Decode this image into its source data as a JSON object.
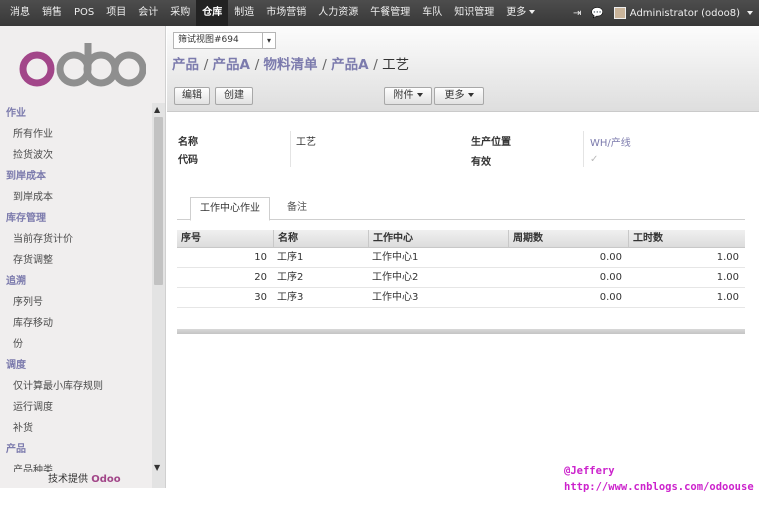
{
  "topbar": {
    "menu": [
      "消息",
      "销售",
      "POS",
      "项目",
      "会计",
      "采购",
      "仓库",
      "制造",
      "市场营销",
      "人力资源",
      "午餐管理",
      "车队",
      "知识管理",
      "更多"
    ],
    "active": "仓库",
    "user": "Administrator (odoo8)"
  },
  "sidebar": {
    "logo": "odoo",
    "sections": [
      {
        "title": "作业",
        "items": [
          "所有作业",
          "捡货波次"
        ]
      },
      {
        "title": "到岸成本",
        "items": [
          "到岸成本"
        ]
      },
      {
        "title": "库存管理",
        "items": [
          "当前存货计价",
          "存货调整"
        ]
      },
      {
        "title": "追溯",
        "items": [
          "序列号",
          "库存移动",
          "份"
        ]
      },
      {
        "title": "调度",
        "items": [
          "仅计算最小库存规则",
          "运行调度",
          "补货"
        ]
      },
      {
        "title": "产品",
        "items": [
          "产品种类"
        ]
      }
    ],
    "powered_prefix": "技术提供",
    "powered_brand": "Odoo"
  },
  "control_panel": {
    "view_selector": "筛试视图#694",
    "breadcrumbs": [
      "产品",
      "产品A",
      "物料清单",
      "产品A"
    ],
    "current": "工艺",
    "edit_label": "编辑",
    "create_label": "创建",
    "attach_label": "附件",
    "more_label": "更多"
  },
  "form": {
    "name_label": "名称",
    "name_value": "工艺",
    "code_label": "代码",
    "code_value": "",
    "location_label": "生产位置",
    "location_value": "WH/产线",
    "active_label": "有效",
    "active_checked": true
  },
  "tabs": [
    "工作中心作业",
    "备注"
  ],
  "grid": {
    "columns": [
      "序号",
      "名称",
      "工作中心",
      "周期数",
      "工时数"
    ],
    "rows": [
      {
        "seq": "10",
        "name": "工序1",
        "wc": "工作中心1",
        "cycles": "0.00",
        "hours": "1.00"
      },
      {
        "seq": "20",
        "name": "工序2",
        "wc": "工作中心2",
        "cycles": "0.00",
        "hours": "1.00"
      },
      {
        "seq": "30",
        "name": "工序3",
        "wc": "工作中心3",
        "cycles": "0.00",
        "hours": "1.00"
      }
    ]
  },
  "watermark": {
    "line1": "@Jeffery",
    "line2": "http://www.cnblogs.com/odoouse"
  },
  "colors": {
    "brand": "#7c7bad",
    "logo": "#a24689",
    "watermark": "#cc22cc"
  }
}
